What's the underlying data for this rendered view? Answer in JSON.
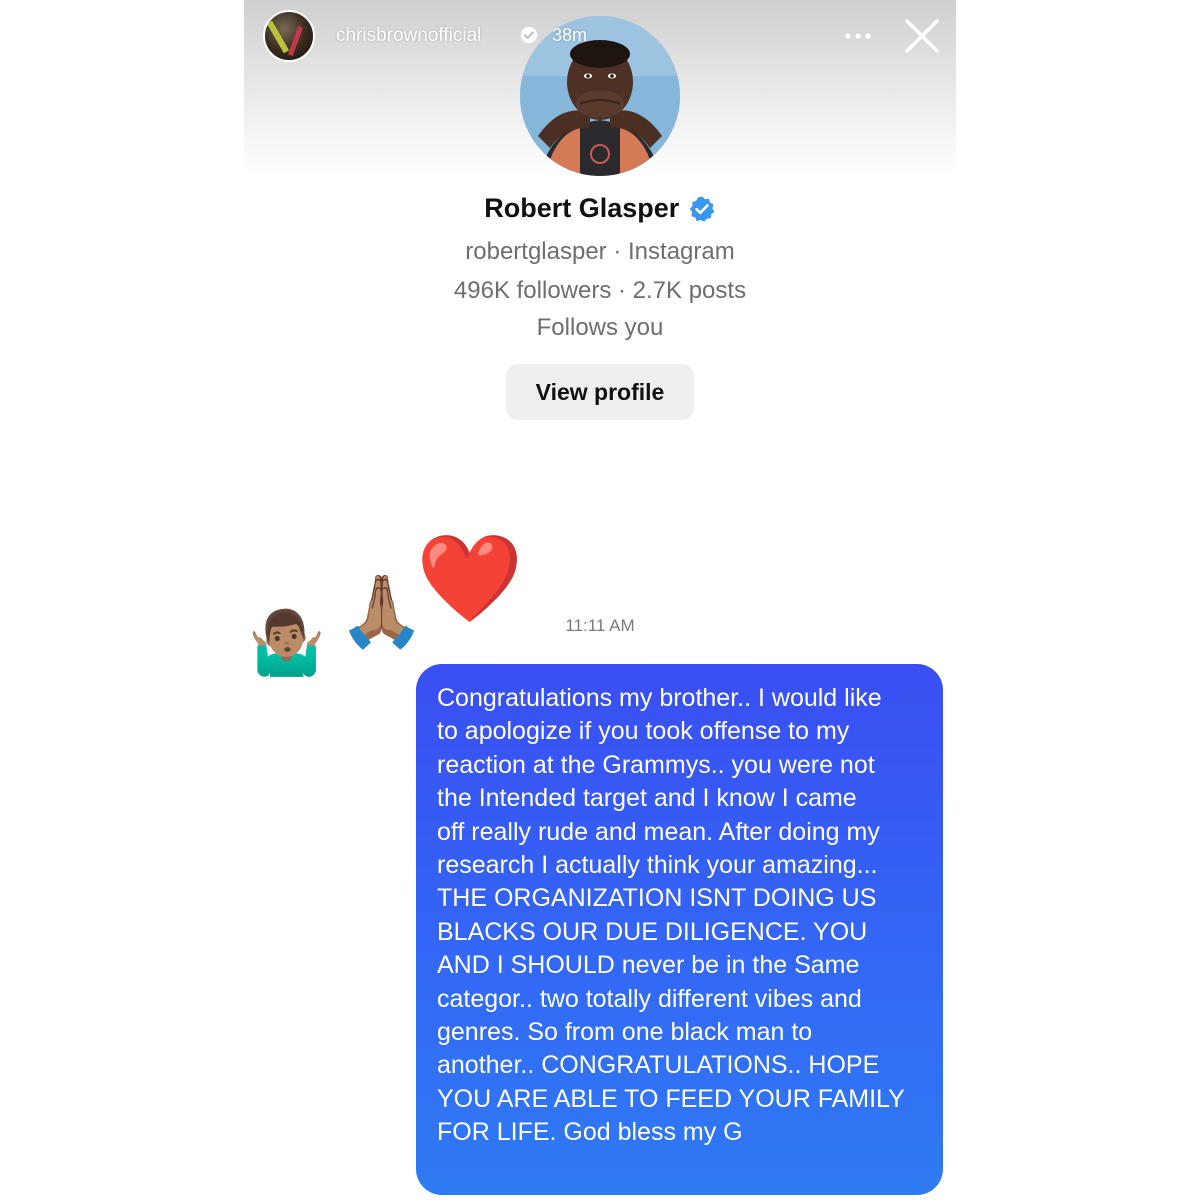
{
  "story": {
    "username": "chrisbrownofficial",
    "time_ago": "38m",
    "more_icon": "more-horizontal-icon",
    "close_icon": "close-icon"
  },
  "profile": {
    "name": "Robert Glasper",
    "verified": true,
    "handle_line": "robertglasper · Instagram",
    "stats_line": "496K followers · 2.7K posts",
    "relation": "Follows you",
    "view_button": "View profile"
  },
  "reactions": {
    "emojis": [
      "🤷🏽‍♂️",
      "🙏🏽",
      "❤️"
    ]
  },
  "message": {
    "time": "11:11 AM",
    "text": "Congratulations my brother.. I would like\nto apologize if you took offense to my\nreaction at the Grammys.. you were not\nthe Intended target and I know I came\noff really rude and mean. After doing my\nresearch I actually think your amazing...\nTHE ORGANIZATION ISNT DOING US\nBLACKS OUR DUE DILIGENCE. YOU\nAND I SHOULD never be in the Same\ncategor.. two totally different vibes and\ngenres. So from one black man to\nanother.. CONGRATULATIONS.. HOPE\nYOU ARE ABLE TO FEED YOUR FAMILY\nFOR LIFE. God bless my G"
  },
  "colors": {
    "bubble_top": "#3a4ef2",
    "bubble_bottom": "#2f7bf3",
    "verified_blue": "#3897f0",
    "button_bg": "#efefef"
  }
}
